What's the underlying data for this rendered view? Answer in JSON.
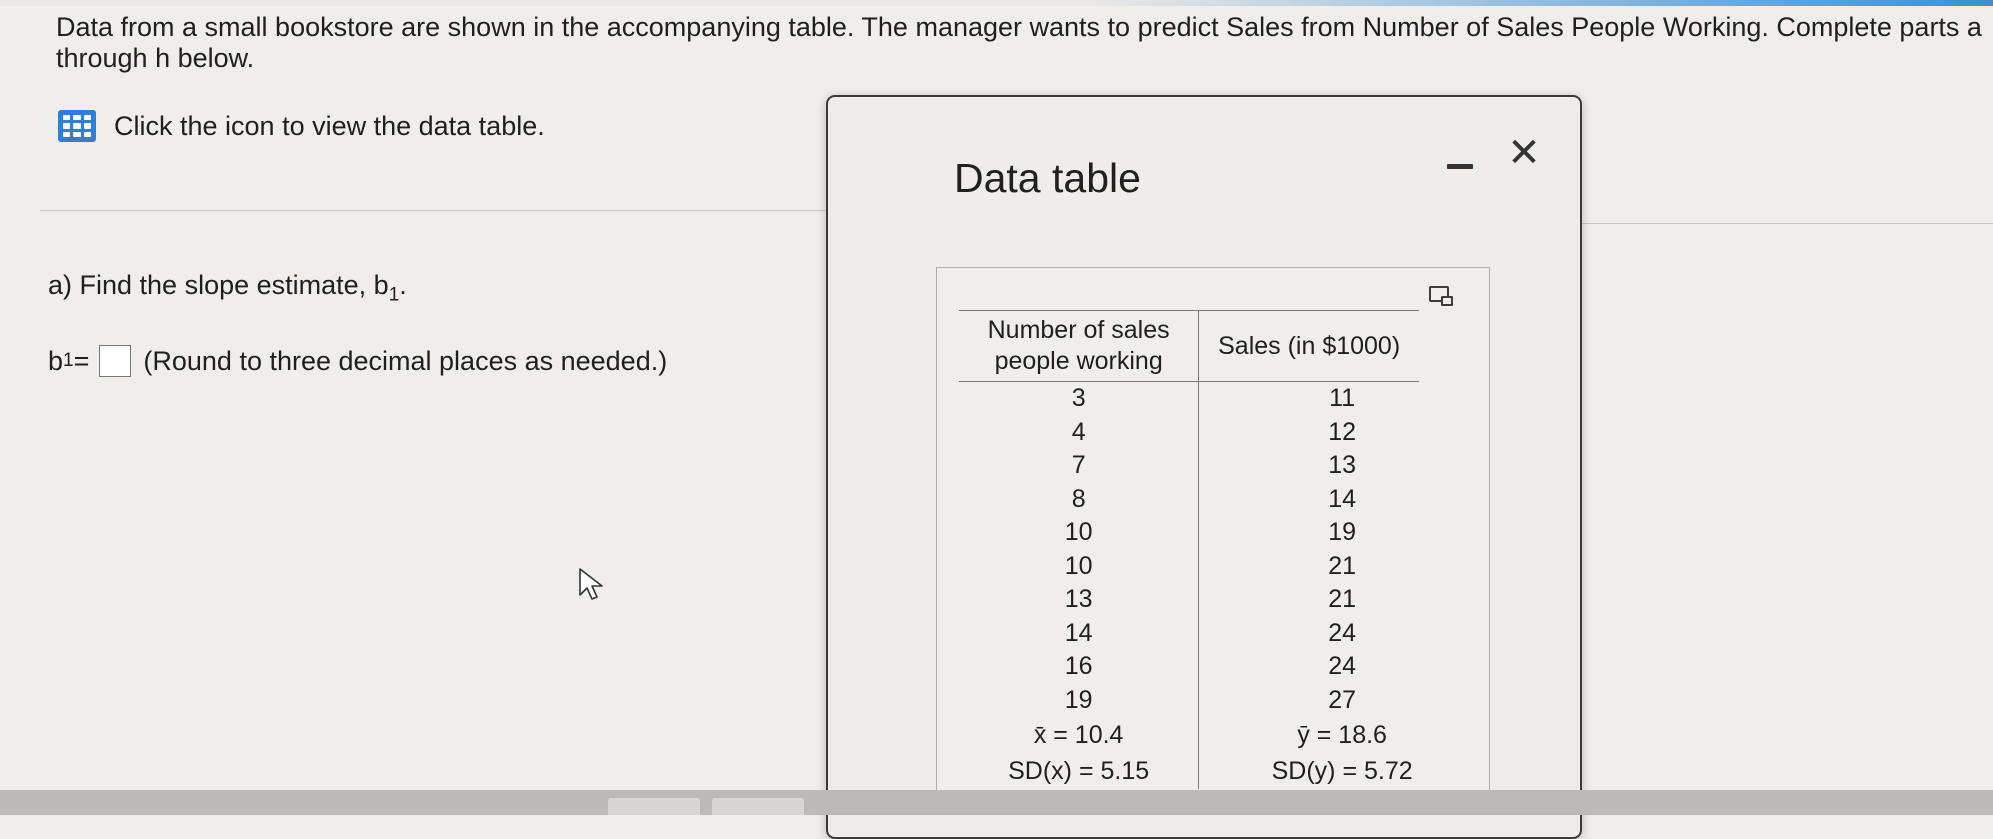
{
  "problem": {
    "statement": "Data from a small bookstore are shown in the accompanying table. The manager wants to predict Sales from Number of Sales People Working. Complete parts a through h below.",
    "data_table_link": "Click the icon to view the data table."
  },
  "question_a": {
    "prompt_prefix": "a) Find the slope estimate, b",
    "prompt_sub": "1",
    "prompt_suffix": ".",
    "answer_prefix": "b",
    "answer_sub": "1",
    "answer_equals": " =",
    "answer_value": "",
    "hint": "(Round to three decimal places as needed.)"
  },
  "modal": {
    "title": "Data table",
    "minimize_icon": "minus-icon",
    "close_glyph": "✕",
    "table": {
      "headers": [
        "Number of sales people working",
        "Sales (in $1000)"
      ],
      "rows": [
        [
          "3",
          "11"
        ],
        [
          "4",
          "12"
        ],
        [
          "7",
          "13"
        ],
        [
          "8",
          "14"
        ],
        [
          "10",
          "19"
        ],
        [
          "10",
          "21"
        ],
        [
          "13",
          "21"
        ],
        [
          "14",
          "24"
        ],
        [
          "16",
          "24"
        ],
        [
          "19",
          "27"
        ]
      ],
      "stats": [
        [
          "x̄ = 10.4",
          "ȳ = 18.6"
        ],
        [
          "SD(x) = 5.15",
          "SD(y) = 5.72"
        ]
      ]
    }
  },
  "colors": {
    "icon_blue": "#2f7ed8",
    "background": "#efeeec",
    "text": "#1f1f1f"
  }
}
